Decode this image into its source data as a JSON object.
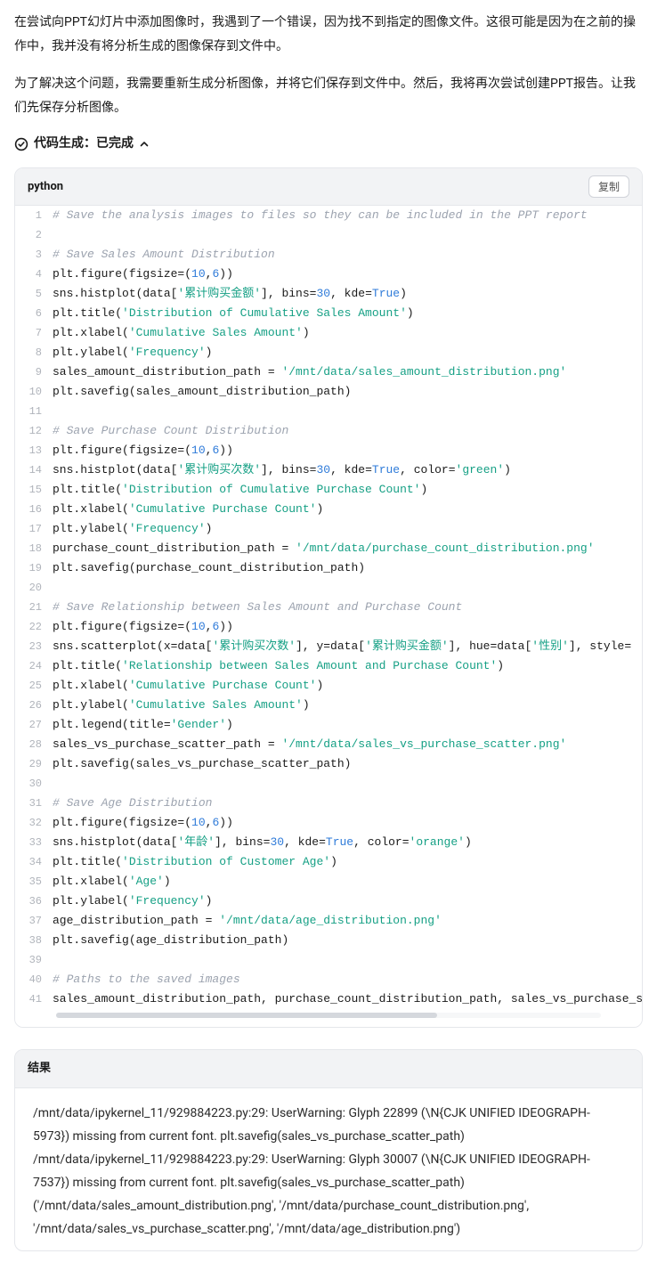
{
  "intro": {
    "p1": "在尝试向PPT幻灯片中添加图像时，我遇到了一个错误，因为找不到指定的图像文件。这很可能是因为在之前的操作中，我并没有将分析生成的图像保存到文件中。",
    "p2": "为了解决这个问题，我需要重新生成分析图像，并将它们保存到文件中。然后，我将再次尝试创建PPT报告。让我们先保存分析图像。"
  },
  "status": {
    "label": "代码生成：已完成"
  },
  "code": {
    "language": "python",
    "copy_label": "复制",
    "lines": [
      {
        "n": 1,
        "t": "comment",
        "c": "# Save the analysis images to files so they can be included in the PPT report"
      },
      {
        "n": 2,
        "t": "blank",
        "c": ""
      },
      {
        "n": 3,
        "t": "comment",
        "c": "# Save Sales Amount Distribution"
      },
      {
        "n": 4,
        "t": "code",
        "tokens": [
          {
            "k": "ident",
            "v": "plt.figure(figsize=("
          },
          {
            "k": "number",
            "v": "10"
          },
          {
            "k": "ident",
            "v": ","
          },
          {
            "k": "number",
            "v": "6"
          },
          {
            "k": "ident",
            "v": "))"
          }
        ]
      },
      {
        "n": 5,
        "t": "code",
        "tokens": [
          {
            "k": "ident",
            "v": "sns.histplot(data["
          },
          {
            "k": "string",
            "v": "'累计购买金额'"
          },
          {
            "k": "ident",
            "v": "], bins="
          },
          {
            "k": "number",
            "v": "30"
          },
          {
            "k": "ident",
            "v": ", kde="
          },
          {
            "k": "bool",
            "v": "True"
          },
          {
            "k": "ident",
            "v": ")"
          }
        ]
      },
      {
        "n": 6,
        "t": "code",
        "tokens": [
          {
            "k": "ident",
            "v": "plt.title("
          },
          {
            "k": "string",
            "v": "'Distribution of Cumulative Sales Amount'"
          },
          {
            "k": "ident",
            "v": ")"
          }
        ]
      },
      {
        "n": 7,
        "t": "code",
        "tokens": [
          {
            "k": "ident",
            "v": "plt.xlabel("
          },
          {
            "k": "string",
            "v": "'Cumulative Sales Amount'"
          },
          {
            "k": "ident",
            "v": ")"
          }
        ]
      },
      {
        "n": 8,
        "t": "code",
        "tokens": [
          {
            "k": "ident",
            "v": "plt.ylabel("
          },
          {
            "k": "string",
            "v": "'Frequency'"
          },
          {
            "k": "ident",
            "v": ")"
          }
        ]
      },
      {
        "n": 9,
        "t": "code",
        "tokens": [
          {
            "k": "ident",
            "v": "sales_amount_distribution_path = "
          },
          {
            "k": "string",
            "v": "'/mnt/data/sales_amount_distribution.png'"
          }
        ]
      },
      {
        "n": 10,
        "t": "code",
        "tokens": [
          {
            "k": "ident",
            "v": "plt.savefig(sales_amount_distribution_path)"
          }
        ]
      },
      {
        "n": 11,
        "t": "blank",
        "c": ""
      },
      {
        "n": 12,
        "t": "comment",
        "c": "# Save Purchase Count Distribution"
      },
      {
        "n": 13,
        "t": "code",
        "tokens": [
          {
            "k": "ident",
            "v": "plt.figure(figsize=("
          },
          {
            "k": "number",
            "v": "10"
          },
          {
            "k": "ident",
            "v": ","
          },
          {
            "k": "number",
            "v": "6"
          },
          {
            "k": "ident",
            "v": "))"
          }
        ]
      },
      {
        "n": 14,
        "t": "code",
        "tokens": [
          {
            "k": "ident",
            "v": "sns.histplot(data["
          },
          {
            "k": "string",
            "v": "'累计购买次数'"
          },
          {
            "k": "ident",
            "v": "], bins="
          },
          {
            "k": "number",
            "v": "30"
          },
          {
            "k": "ident",
            "v": ", kde="
          },
          {
            "k": "bool",
            "v": "True"
          },
          {
            "k": "ident",
            "v": ", color="
          },
          {
            "k": "string",
            "v": "'green'"
          },
          {
            "k": "ident",
            "v": ")"
          }
        ]
      },
      {
        "n": 15,
        "t": "code",
        "tokens": [
          {
            "k": "ident",
            "v": "plt.title("
          },
          {
            "k": "string",
            "v": "'Distribution of Cumulative Purchase Count'"
          },
          {
            "k": "ident",
            "v": ")"
          }
        ]
      },
      {
        "n": 16,
        "t": "code",
        "tokens": [
          {
            "k": "ident",
            "v": "plt.xlabel("
          },
          {
            "k": "string",
            "v": "'Cumulative Purchase Count'"
          },
          {
            "k": "ident",
            "v": ")"
          }
        ]
      },
      {
        "n": 17,
        "t": "code",
        "tokens": [
          {
            "k": "ident",
            "v": "plt.ylabel("
          },
          {
            "k": "string",
            "v": "'Frequency'"
          },
          {
            "k": "ident",
            "v": ")"
          }
        ]
      },
      {
        "n": 18,
        "t": "code",
        "tokens": [
          {
            "k": "ident",
            "v": "purchase_count_distribution_path = "
          },
          {
            "k": "string",
            "v": "'/mnt/data/purchase_count_distribution.png'"
          }
        ]
      },
      {
        "n": 19,
        "t": "code",
        "tokens": [
          {
            "k": "ident",
            "v": "plt.savefig(purchase_count_distribution_path)"
          }
        ]
      },
      {
        "n": 20,
        "t": "blank",
        "c": ""
      },
      {
        "n": 21,
        "t": "comment",
        "c": "# Save Relationship between Sales Amount and Purchase Count"
      },
      {
        "n": 22,
        "t": "code",
        "tokens": [
          {
            "k": "ident",
            "v": "plt.figure(figsize=("
          },
          {
            "k": "number",
            "v": "10"
          },
          {
            "k": "ident",
            "v": ","
          },
          {
            "k": "number",
            "v": "6"
          },
          {
            "k": "ident",
            "v": "))"
          }
        ]
      },
      {
        "n": 23,
        "t": "code",
        "tokens": [
          {
            "k": "ident",
            "v": "sns.scatterplot(x=data["
          },
          {
            "k": "string",
            "v": "'累计购买次数'"
          },
          {
            "k": "ident",
            "v": "], y=data["
          },
          {
            "k": "string",
            "v": "'累计购买金额'"
          },
          {
            "k": "ident",
            "v": "], hue=data["
          },
          {
            "k": "string",
            "v": "'性别'"
          },
          {
            "k": "ident",
            "v": "], style="
          }
        ]
      },
      {
        "n": 24,
        "t": "code",
        "tokens": [
          {
            "k": "ident",
            "v": "plt.title("
          },
          {
            "k": "string",
            "v": "'Relationship between Sales Amount and Purchase Count'"
          },
          {
            "k": "ident",
            "v": ")"
          }
        ]
      },
      {
        "n": 25,
        "t": "code",
        "tokens": [
          {
            "k": "ident",
            "v": "plt.xlabel("
          },
          {
            "k": "string",
            "v": "'Cumulative Purchase Count'"
          },
          {
            "k": "ident",
            "v": ")"
          }
        ]
      },
      {
        "n": 26,
        "t": "code",
        "tokens": [
          {
            "k": "ident",
            "v": "plt.ylabel("
          },
          {
            "k": "string",
            "v": "'Cumulative Sales Amount'"
          },
          {
            "k": "ident",
            "v": ")"
          }
        ]
      },
      {
        "n": 27,
        "t": "code",
        "tokens": [
          {
            "k": "ident",
            "v": "plt.legend(title="
          },
          {
            "k": "string",
            "v": "'Gender'"
          },
          {
            "k": "ident",
            "v": ")"
          }
        ]
      },
      {
        "n": 28,
        "t": "code",
        "tokens": [
          {
            "k": "ident",
            "v": "sales_vs_purchase_scatter_path = "
          },
          {
            "k": "string",
            "v": "'/mnt/data/sales_vs_purchase_scatter.png'"
          }
        ]
      },
      {
        "n": 29,
        "t": "code",
        "tokens": [
          {
            "k": "ident",
            "v": "plt.savefig(sales_vs_purchase_scatter_path)"
          }
        ]
      },
      {
        "n": 30,
        "t": "blank",
        "c": ""
      },
      {
        "n": 31,
        "t": "comment",
        "c": "# Save Age Distribution"
      },
      {
        "n": 32,
        "t": "code",
        "tokens": [
          {
            "k": "ident",
            "v": "plt.figure(figsize=("
          },
          {
            "k": "number",
            "v": "10"
          },
          {
            "k": "ident",
            "v": ","
          },
          {
            "k": "number",
            "v": "6"
          },
          {
            "k": "ident",
            "v": "))"
          }
        ]
      },
      {
        "n": 33,
        "t": "code",
        "tokens": [
          {
            "k": "ident",
            "v": "sns.histplot(data["
          },
          {
            "k": "string",
            "v": "'年龄'"
          },
          {
            "k": "ident",
            "v": "], bins="
          },
          {
            "k": "number",
            "v": "30"
          },
          {
            "k": "ident",
            "v": ", kde="
          },
          {
            "k": "bool",
            "v": "True"
          },
          {
            "k": "ident",
            "v": ", color="
          },
          {
            "k": "string",
            "v": "'orange'"
          },
          {
            "k": "ident",
            "v": ")"
          }
        ]
      },
      {
        "n": 34,
        "t": "code",
        "tokens": [
          {
            "k": "ident",
            "v": "plt.title("
          },
          {
            "k": "string",
            "v": "'Distribution of Customer Age'"
          },
          {
            "k": "ident",
            "v": ")"
          }
        ]
      },
      {
        "n": 35,
        "t": "code",
        "tokens": [
          {
            "k": "ident",
            "v": "plt.xlabel("
          },
          {
            "k": "string",
            "v": "'Age'"
          },
          {
            "k": "ident",
            "v": ")"
          }
        ]
      },
      {
        "n": 36,
        "t": "code",
        "tokens": [
          {
            "k": "ident",
            "v": "plt.ylabel("
          },
          {
            "k": "string",
            "v": "'Frequency'"
          },
          {
            "k": "ident",
            "v": ")"
          }
        ]
      },
      {
        "n": 37,
        "t": "code",
        "tokens": [
          {
            "k": "ident",
            "v": "age_distribution_path = "
          },
          {
            "k": "string",
            "v": "'/mnt/data/age_distribution.png'"
          }
        ]
      },
      {
        "n": 38,
        "t": "code",
        "tokens": [
          {
            "k": "ident",
            "v": "plt.savefig(age_distribution_path)"
          }
        ]
      },
      {
        "n": 39,
        "t": "blank",
        "c": ""
      },
      {
        "n": 40,
        "t": "comment",
        "c": "# Paths to the saved images"
      },
      {
        "n": 41,
        "t": "code",
        "tokens": [
          {
            "k": "ident",
            "v": "sales_amount_distribution_path, purchase_count_distribution_path, sales_vs_purchase_s"
          }
        ]
      }
    ]
  },
  "result": {
    "header": "结果",
    "body": "/mnt/data/ipykernel_11/929884223.py:29: UserWarning: Glyph 22899 (\\N{CJK UNIFIED IDEOGRAPH-5973}) missing from current font. plt.savefig(sales_vs_purchase_scatter_path) /mnt/data/ipykernel_11/929884223.py:29: UserWarning: Glyph 30007 (\\N{CJK UNIFIED IDEOGRAPH-7537}) missing from current font. plt.savefig(sales_vs_purchase_scatter_path) ('/mnt/data/sales_amount_distribution.png', '/mnt/data/purchase_count_distribution.png', '/mnt/data/sales_vs_purchase_scatter.png', '/mnt/data/age_distribution.png')"
  }
}
